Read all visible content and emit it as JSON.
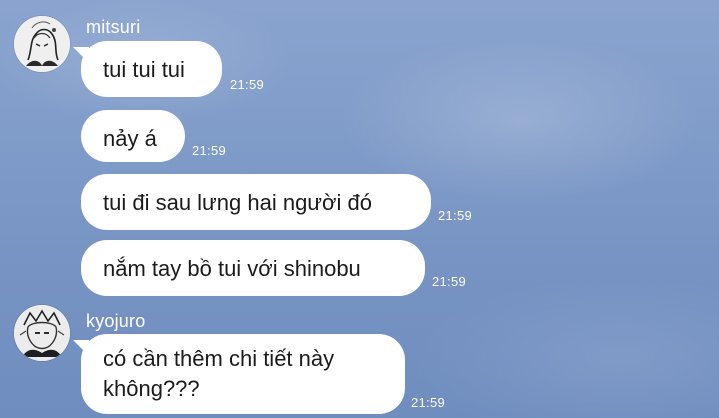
{
  "messages": [
    {
      "sender": "mitsuri",
      "text": "tui tui tui",
      "time": "21:59"
    },
    {
      "sender": "mitsuri",
      "text": "nảy á",
      "time": "21:59"
    },
    {
      "sender": "mitsuri",
      "text": "tui đi sau lưng hai người đó",
      "time": "21:59"
    },
    {
      "sender": "mitsuri",
      "text": "nắm tay bồ tui với shinobu",
      "time": "21:59"
    },
    {
      "sender": "kyojuro",
      "text_line1": "có cần thêm chi tiết này",
      "text_line2": "không???",
      "time": "21:59"
    }
  ],
  "senders": {
    "mitsuri": {
      "name": "mitsuri",
      "avatar_icon": "sketch-avatar-icon"
    },
    "kyojuro": {
      "name": "kyojuro",
      "avatar_icon": "sketch-avatar-icon"
    }
  }
}
